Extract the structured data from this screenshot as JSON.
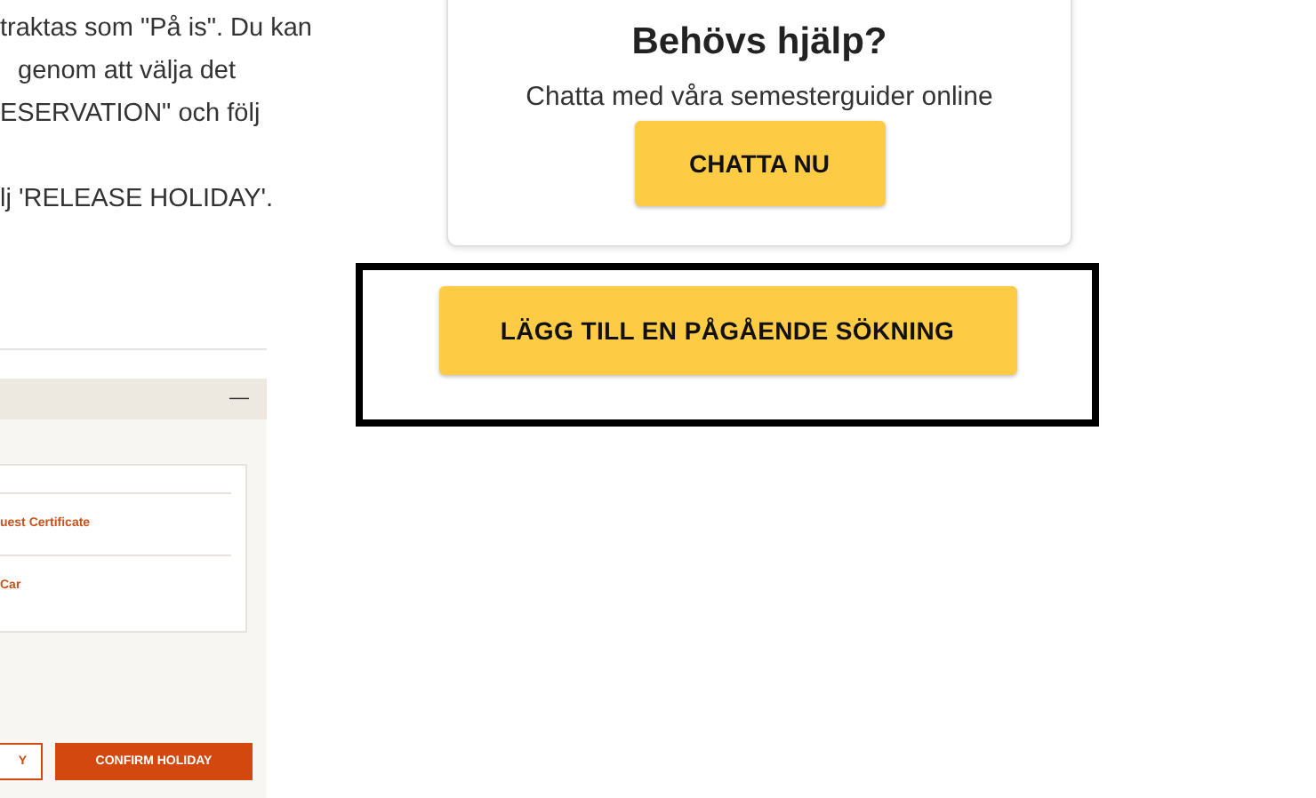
{
  "article": {
    "paragraphs": [
      [
        "traktas som \"På is\". Du kan",
        "genom att välja det",
        "ESERVATION\" och följ"
      ],
      [
        "lj 'RELEASE HOLIDAY'."
      ]
    ]
  },
  "embedded_screenshot": {
    "collapse_symbol": "—",
    "items": [
      "uest Certificate",
      "Car"
    ],
    "buttons": [
      {
        "label": "Y",
        "kind": "outline"
      },
      {
        "label": "CONFIRM HOLIDAY",
        "kind": "filled"
      }
    ]
  },
  "help_card": {
    "title": "Behövs hjälp?",
    "subtitle": "Chatta med våra semesterguider online",
    "button": "CHATTA NU"
  },
  "highlighted_button": {
    "label": "LÄGG TILL EN PÅGÅENDE SÖKNING"
  }
}
